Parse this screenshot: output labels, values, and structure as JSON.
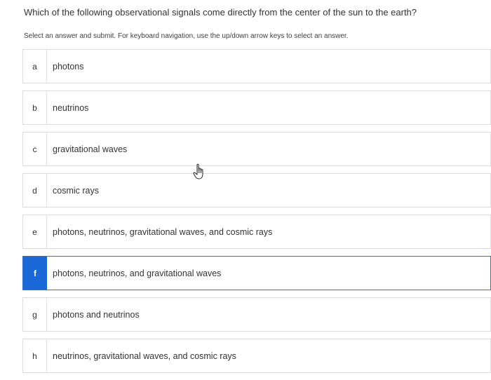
{
  "question": "Which of the following observational signals come directly from the center of the sun to the earth?",
  "instructions": "Select an answer and submit. For keyboard navigation, use the up/down arrow keys to select an answer.",
  "options": [
    {
      "letter": "a",
      "text": "photons"
    },
    {
      "letter": "b",
      "text": "neutrinos"
    },
    {
      "letter": "c",
      "text": "gravitational waves"
    },
    {
      "letter": "d",
      "text": "cosmic rays"
    },
    {
      "letter": "e",
      "text": "photons, neutrinos, gravitational waves, and cosmic rays"
    },
    {
      "letter": "f",
      "text": "photons, neutrinos, and gravitational waves"
    },
    {
      "letter": "g",
      "text": "photons and neutrinos"
    },
    {
      "letter": "h",
      "text": "neutrinos, gravitational waves, and cosmic rays"
    }
  ],
  "selected_option": "f",
  "colors": {
    "accent": "#1a67d8",
    "border": "#dcdcdc"
  },
  "icons": {
    "cursor": "hand-pointer-icon"
  }
}
